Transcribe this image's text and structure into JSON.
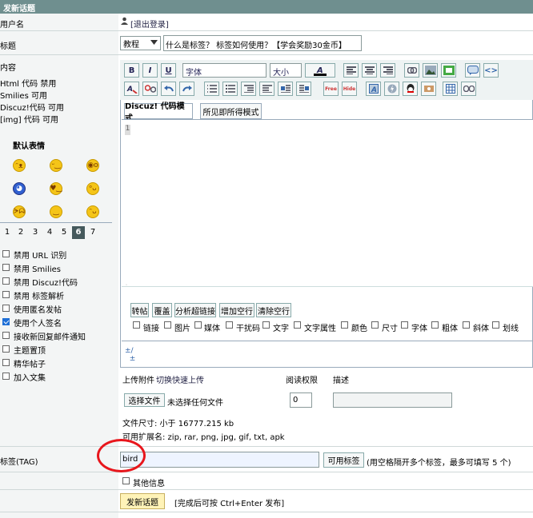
{
  "header": {
    "title": "发新话题"
  },
  "username": {
    "label": "用户名",
    "user_icon": "user-icon",
    "logout": "[退出登录]"
  },
  "title_row": {
    "label": "标题",
    "category": "教程",
    "title_value": "什么是标签？ 标签如何使用？【学会奖励30金币】"
  },
  "content": {
    "label": "内容",
    "features": [
      "Html 代码 禁用",
      "Smilies 可用",
      "Discuz!代码 可用",
      "[img] 代码 可用"
    ],
    "smilies_title": "默认表情",
    "pages": [
      "1",
      "2",
      "3",
      "4",
      "5",
      "6",
      "7"
    ],
    "active_page": "6",
    "options": [
      {
        "label": "禁用 URL 识别",
        "checked": false
      },
      {
        "label": "禁用 Smilies",
        "checked": false
      },
      {
        "label": "禁用 Discuz!代码",
        "checked": false
      },
      {
        "label": "禁用 标签解析",
        "checked": false
      },
      {
        "label": "使用匿名发帖",
        "checked": false
      },
      {
        "label": "使用个人签名",
        "checked": true
      },
      {
        "label": "接收新回复邮件通知",
        "checked": false
      },
      {
        "label": "主题置顶",
        "checked": false
      },
      {
        "label": "精华帖子",
        "checked": false
      },
      {
        "label": "加入文集",
        "checked": false
      }
    ]
  },
  "editor": {
    "font_select": "字体",
    "size_select": "大小",
    "tabs": [
      "Discuz! 代码模式",
      "所见即所得模式"
    ],
    "line_number": "1",
    "action_buttons": [
      "转帖",
      "覆盖",
      "分析超链接",
      "增加空行",
      "清除空行"
    ],
    "filters": [
      "链接",
      "图片",
      "媒体",
      "干扰码",
      "文字",
      "文字属性",
      "颜色",
      "尺寸",
      "字体",
      "粗体",
      "斜体",
      "划线"
    ],
    "toolbar_row1": [
      "B",
      "I",
      "U"
    ],
    "toolbar_row2_labels": [
      "Free",
      "Hide"
    ]
  },
  "attachments": {
    "upload_label": "上传附件",
    "switch_label": "切换快速上传",
    "perm_label": "阅读权限",
    "desc_label": "描述",
    "choose_file": "选择文件",
    "no_file": "未选择任何文件",
    "perm_value": "0",
    "size_info": "文件尺寸: 小于 16777.215 kb",
    "ext_info": "可用扩展名: zip, rar, png, jpg, gif, txt, apk"
  },
  "tag": {
    "label": "标签(TAG)",
    "value": "bird",
    "button": "可用标签",
    "hint": "(用空格隔开多个标签，最多可填写 5 个)"
  },
  "other": {
    "label": "其他信息"
  },
  "submit": {
    "button": "发新话题",
    "hint": "[完成后可按 Ctrl+Enter 发布]"
  }
}
